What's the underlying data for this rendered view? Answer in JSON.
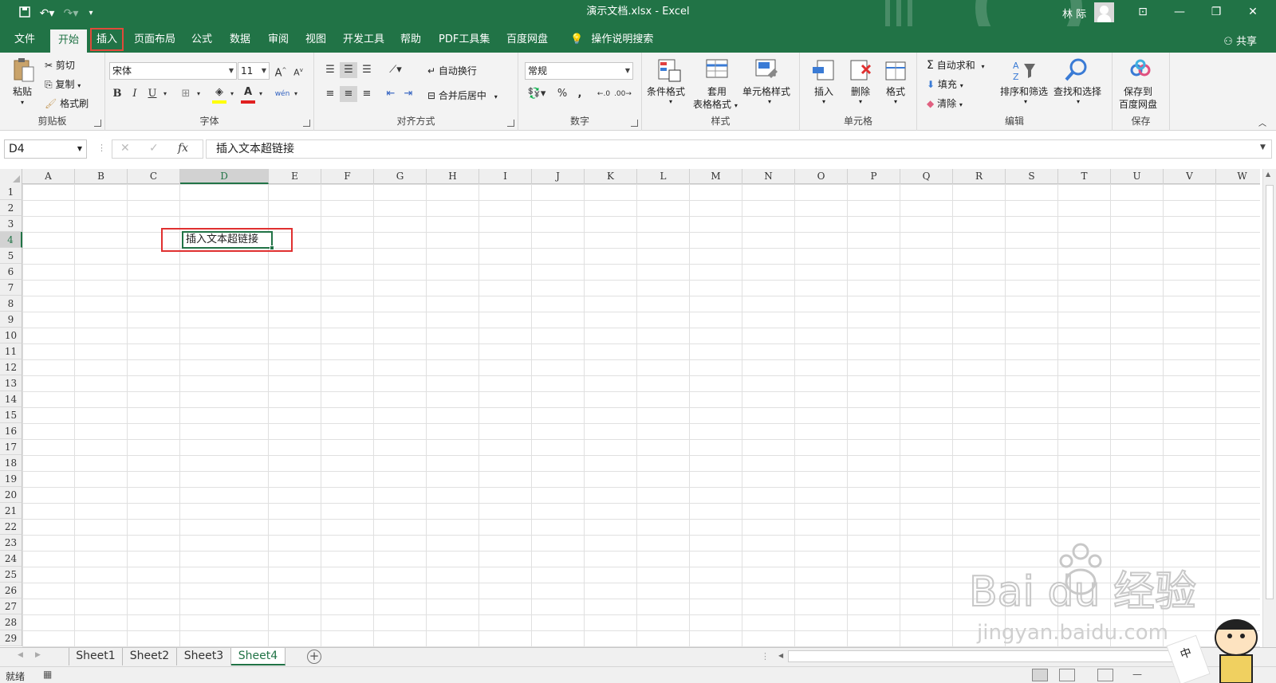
{
  "window": {
    "title": "演示文档.xlsx  -  Excel",
    "user_name": "林 际",
    "colors": {
      "accent": "#217346",
      "highlight_box": "#e03030"
    }
  },
  "ribbon_tabs": [
    "文件",
    "开始",
    "插入",
    "页面布局",
    "公式",
    "数据",
    "审阅",
    "视图",
    "开发工具",
    "帮助",
    "PDF工具集",
    "百度网盘"
  ],
  "tell_me": "操作说明搜索",
  "share_label": "共享",
  "clipboard": {
    "paste": "粘贴",
    "cut": "剪切",
    "copy": "复制",
    "format_painter": "格式刷",
    "label": "剪贴板"
  },
  "font": {
    "name": "宋体",
    "size": "11",
    "label": "字体",
    "bold": "B",
    "italic": "I",
    "underline": "U",
    "phonetic": "wén"
  },
  "alignment": {
    "wrap": "自动换行",
    "merge": "合并后居中",
    "label": "对齐方式"
  },
  "number": {
    "format": "常规",
    "percent": "%",
    "comma": ",",
    "label": "数字"
  },
  "styles": {
    "conditional": "条件格式",
    "table_fmt_1": "套用",
    "table_fmt_2": "表格格式",
    "cell_styles": "单元格样式",
    "label": "样式"
  },
  "cells_group": {
    "insert": "插入",
    "delete": "删除",
    "format": "格式",
    "label": "单元格"
  },
  "editing": {
    "autosum": "自动求和",
    "fill": "填充",
    "clear": "清除",
    "sort_filter": "排序和筛选",
    "find_select": "查找和选择",
    "label": "编辑"
  },
  "save_group": {
    "save_1": "保存到",
    "save_2": "百度网盘",
    "label": "保存"
  },
  "formula_bar": {
    "name_box": "D4",
    "fx": "fx",
    "content": "插入文本超链接"
  },
  "columns": [
    "A",
    "B",
    "C",
    "D",
    "E",
    "F",
    "G",
    "H",
    "I",
    "J",
    "K",
    "L",
    "M",
    "N",
    "O",
    "P",
    "Q",
    "R",
    "S",
    "T",
    "U",
    "V",
    "W"
  ],
  "rows": [
    "1",
    "2",
    "3",
    "4",
    "5",
    "6",
    "7",
    "8",
    "9",
    "10",
    "11",
    "12",
    "13",
    "14",
    "15",
    "16",
    "17",
    "18",
    "19",
    "20",
    "21",
    "22",
    "23",
    "24",
    "25",
    "26",
    "27",
    "28",
    "29"
  ],
  "cell_D4": "插入文本超链接",
  "sheets": [
    "Sheet1",
    "Sheet2",
    "Sheet3",
    "Sheet4"
  ],
  "active_sheet": "Sheet4",
  "status": "就绪",
  "watermark": {
    "brand": "Bai du 经验",
    "url": "jingyan.baidu.com"
  },
  "ime": "中"
}
